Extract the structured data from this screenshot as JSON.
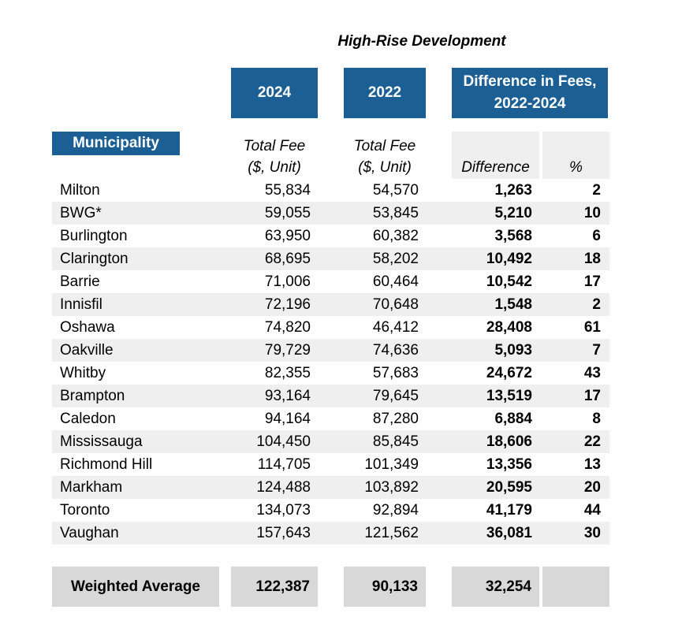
{
  "title": "High-Rise Development",
  "headers": {
    "col_2024": "2024",
    "col_2022": "2022",
    "col_diff": "Difference in Fees, 2022-2024",
    "municipality": "Municipality",
    "sub_total_fee_1": "Total Fee",
    "sub_total_fee_2": "($, Unit)",
    "sub_total_fee_b1": "Total Fee",
    "sub_total_fee_b2": "($, Unit)",
    "sub_difference": "Difference",
    "sub_percent": "%"
  },
  "rows": [
    {
      "name": "Milton",
      "fee2024": "55,834",
      "fee2022": "54,570",
      "diff": "1,263",
      "pct": "2"
    },
    {
      "name": "BWG*",
      "fee2024": "59,055",
      "fee2022": "53,845",
      "diff": "5,210",
      "pct": "10"
    },
    {
      "name": "Burlington",
      "fee2024": "63,950",
      "fee2022": "60,382",
      "diff": "3,568",
      "pct": "6"
    },
    {
      "name": "Clarington",
      "fee2024": "68,695",
      "fee2022": "58,202",
      "diff": "10,492",
      "pct": "18"
    },
    {
      "name": "Barrie",
      "fee2024": "71,006",
      "fee2022": "60,464",
      "diff": "10,542",
      "pct": "17"
    },
    {
      "name": "Innisfil",
      "fee2024": "72,196",
      "fee2022": "70,648",
      "diff": "1,548",
      "pct": "2"
    },
    {
      "name": "Oshawa",
      "fee2024": "74,820",
      "fee2022": "46,412",
      "diff": "28,408",
      "pct": "61"
    },
    {
      "name": "Oakville",
      "fee2024": "79,729",
      "fee2022": "74,636",
      "diff": "5,093",
      "pct": "7"
    },
    {
      "name": "Whitby",
      "fee2024": "82,355",
      "fee2022": "57,683",
      "diff": "24,672",
      "pct": "43"
    },
    {
      "name": "Brampton",
      "fee2024": "93,164",
      "fee2022": "79,645",
      "diff": "13,519",
      "pct": "17"
    },
    {
      "name": "Caledon",
      "fee2024": "94,164",
      "fee2022": "87,280",
      "diff": "6,884",
      "pct": "8"
    },
    {
      "name": "Mississauga",
      "fee2024": "104,450",
      "fee2022": "85,845",
      "diff": "18,606",
      "pct": "22"
    },
    {
      "name": "Richmond Hill",
      "fee2024": "114,705",
      "fee2022": "101,349",
      "diff": "13,356",
      "pct": "13"
    },
    {
      "name": "Markham",
      "fee2024": "124,488",
      "fee2022": "103,892",
      "diff": "20,595",
      "pct": "20"
    },
    {
      "name": "Toronto",
      "fee2024": "134,073",
      "fee2022": "92,894",
      "diff": "41,179",
      "pct": "44"
    },
    {
      "name": "Vaughan",
      "fee2024": "157,643",
      "fee2022": "121,562",
      "diff": "36,081",
      "pct": "30"
    }
  ],
  "average": {
    "label": "Weighted Average",
    "fee2024": "122,387",
    "fee2022": "90,133",
    "diff": "32,254"
  },
  "colors": {
    "header_blue": "#1b5f94",
    "band_gray": "#efefef",
    "average_gray": "#d8d8d8"
  }
}
